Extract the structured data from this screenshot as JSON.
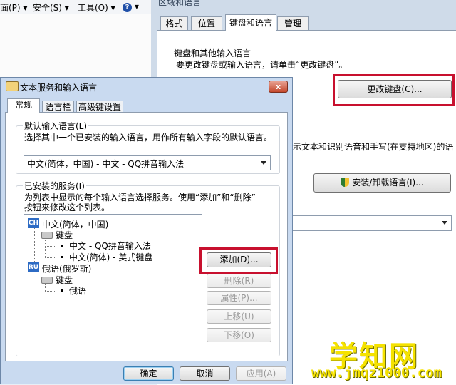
{
  "ie_toolbar": {
    "page_menu": "面(P) ▾",
    "safety_menu": "安全(S) ▾",
    "tools_menu": "工具(O) ▾",
    "help_menu": "▾"
  },
  "region_window": {
    "title": "区域和语言",
    "tabs": [
      "格式",
      "位置",
      "键盘和语言",
      "管理"
    ],
    "active_tab": "键盘和语言",
    "kb_group_title": "键盘和其他输入语言",
    "kb_desc": "要更改键盘或输入语言，请单击“更改键盘”。",
    "change_kb_button": "更改键盘(C)...",
    "display_desc": "示文本和识别语音和手写(在支持地区)的语",
    "install_button": "安装/卸载语言(I)..."
  },
  "dialog": {
    "title": "文本服务和输入语言",
    "close": "x",
    "tabs": [
      "常规",
      "语言栏",
      "高级键设置"
    ],
    "active_tab": "常规",
    "default_group": "默认输入语言(L)",
    "default_desc": "选择其中一个已安装的输入语言，用作所有输入字段的默认语言。",
    "default_value": "中文(简体，中国) - 中文 - QQ拼音输入法",
    "installed_group": "已安装的服务(I)",
    "installed_desc_1": "为列表中显示的每个输入语言选择服务。使用“添加”和“删除”",
    "installed_desc_2": "按钮来修改这个列表。",
    "tree": {
      "lang1_badge": "CH",
      "lang1": "中文(简体，中国)",
      "lang1_kb": "键盘",
      "lang1_items": [
        "中文 - QQ拼音输入法",
        "中文(简体) - 美式键盘"
      ],
      "lang2_badge": "RU",
      "lang2": "俄语(俄罗斯)",
      "lang2_kb": "键盘",
      "lang2_items": [
        "俄语"
      ]
    },
    "buttons": {
      "add": "添加(D)...",
      "remove": "删除(R)",
      "properties": "属性(P)...",
      "move_up": "上移(U)",
      "move_down": "下移(O)",
      "ok": "确定",
      "cancel": "取消",
      "apply": "应用(A)"
    }
  },
  "watermark": {
    "brand": "学知网",
    "url": "www.jmqz1000.com"
  },
  "colors": {
    "highlight": "#c8102e",
    "watermark": "#f5e200"
  }
}
